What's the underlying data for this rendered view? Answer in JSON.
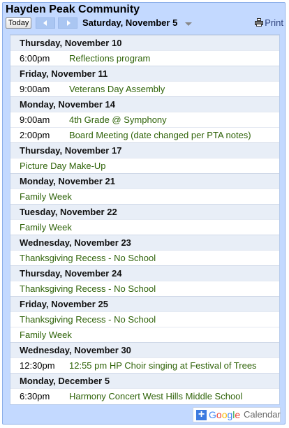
{
  "header": {
    "calendar_title": "Hayden Peak Community",
    "today_label": "Today",
    "date_range": "Saturday, November 5",
    "print_label": "Print"
  },
  "agenda": [
    {
      "day": "Thursday, November 10",
      "events": [
        {
          "time": "6:00pm",
          "title": "Reflections program"
        }
      ]
    },
    {
      "day": "Friday, November 11",
      "events": [
        {
          "time": "9:00am",
          "title": "Veterans Day Assembly"
        }
      ]
    },
    {
      "day": "Monday, November 14",
      "events": [
        {
          "time": "9:00am",
          "title": "4th Grade @ Symphony"
        },
        {
          "time": "2:00pm",
          "title": "Board Meeting (date changed per PTA notes)"
        }
      ]
    },
    {
      "day": "Thursday, November 17",
      "events": [
        {
          "time": "",
          "title": "Picture Day Make-Up"
        }
      ]
    },
    {
      "day": "Monday, November 21",
      "events": [
        {
          "time": "",
          "title": "Family Week"
        }
      ]
    },
    {
      "day": "Tuesday, November 22",
      "events": [
        {
          "time": "",
          "title": "Family Week"
        }
      ]
    },
    {
      "day": "Wednesday, November 23",
      "events": [
        {
          "time": "",
          "title": "Thanksgiving Recess - No School"
        }
      ]
    },
    {
      "day": "Thursday, November 24",
      "events": [
        {
          "time": "",
          "title": "Thanksgiving Recess - No School"
        }
      ]
    },
    {
      "day": "Friday, November 25",
      "events": [
        {
          "time": "",
          "title": "Thanksgiving Recess - No School"
        },
        {
          "time": "",
          "title": "Family Week"
        }
      ]
    },
    {
      "day": "Wednesday, November 30",
      "events": [
        {
          "time": "12:30pm",
          "title": "12:55 pm HP Choir singing at Festival of Trees"
        }
      ]
    },
    {
      "day": "Monday, December 5",
      "events": [
        {
          "time": "6:30pm",
          "title": "Harmony Concert West Hills Middle School"
        }
      ]
    }
  ],
  "footer": {
    "google_letters": [
      "G",
      "o",
      "o",
      "g",
      "l",
      "e"
    ],
    "calendar_word": "Calendar"
  },
  "colors": {
    "frame_bg": "#c3d9ff",
    "day_header_bg": "#e8eef7",
    "event_title": "#2f6309"
  },
  "icons": [
    "arrow-left-icon",
    "arrow-right-icon",
    "dropdown-arrow-icon",
    "printer-icon",
    "plus-icon"
  ]
}
